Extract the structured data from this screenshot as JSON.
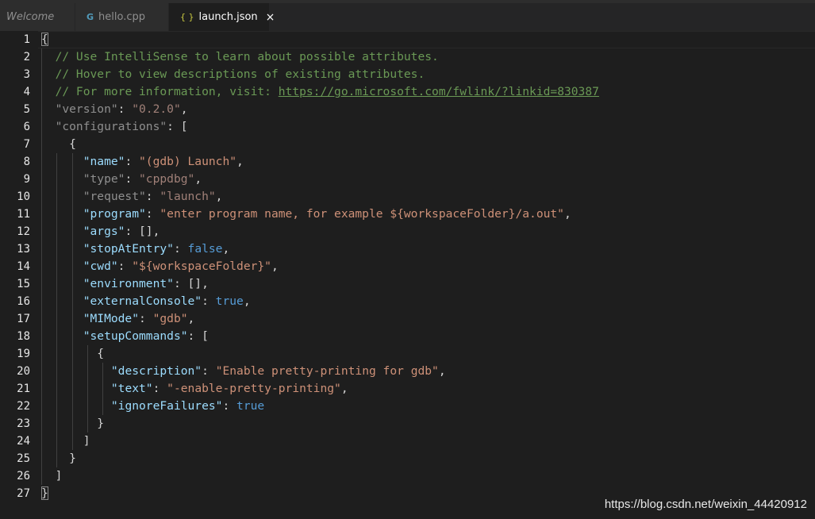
{
  "tabs": [
    {
      "label": "Welcome",
      "icon": "welcome"
    },
    {
      "label": "hello.cpp",
      "icon": "cpp-file-icon"
    },
    {
      "label": "launch.json",
      "icon": "json-file-icon",
      "close": "×"
    }
  ],
  "editor": {
    "line_numbers": [
      "1",
      "2",
      "3",
      "4",
      "5",
      "6",
      "7",
      "8",
      "9",
      "10",
      "11",
      "12",
      "13",
      "14",
      "15",
      "16",
      "17",
      "18",
      "19",
      "20",
      "21",
      "22",
      "23",
      "24",
      "25",
      "26",
      "27"
    ],
    "comment1": "// Use IntelliSense to learn about possible attributes.",
    "comment2": "// Hover to view descriptions of existing attributes.",
    "comment3_prefix": "// For more information, visit: ",
    "comment3_link": "https://go.microsoft.com/fwlink/?linkid=830387",
    "version_key": "\"version\"",
    "version_val": "\"0.2.0\"",
    "configurations_key": "\"configurations\"",
    "name_key": "\"name\"",
    "name_val": "\"(gdb) Launch\"",
    "type_key": "\"type\"",
    "type_val": "\"cppdbg\"",
    "request_key": "\"request\"",
    "request_val": "\"launch\"",
    "program_key": "\"program\"",
    "program_val": "\"enter program name, for example ${workspaceFolder}/a.out\"",
    "args_key": "\"args\"",
    "stop_key": "\"stopAtEntry\"",
    "stop_val": "false",
    "cwd_key": "\"cwd\"",
    "cwd_val": "\"${workspaceFolder}\"",
    "env_key": "\"environment\"",
    "ext_key": "\"externalConsole\"",
    "ext_val": "true",
    "mimode_key": "\"MIMode\"",
    "mimode_val": "\"gdb\"",
    "setup_key": "\"setupCommands\"",
    "desc_key": "\"description\"",
    "desc_val": "\"Enable pretty-printing for gdb\"",
    "text_key": "\"text\"",
    "text_val": "\"-enable-pretty-printing\"",
    "ignore_key": "\"ignoreFailures\"",
    "ignore_val": "true"
  },
  "watermark": "https://blog.csdn.net/weixin_44420912",
  "colors": {
    "background": "#1e1e1e",
    "key": "#9cdcfe",
    "string": "#ce9178",
    "keyword": "#569cd6",
    "comment": "#6a9955"
  }
}
